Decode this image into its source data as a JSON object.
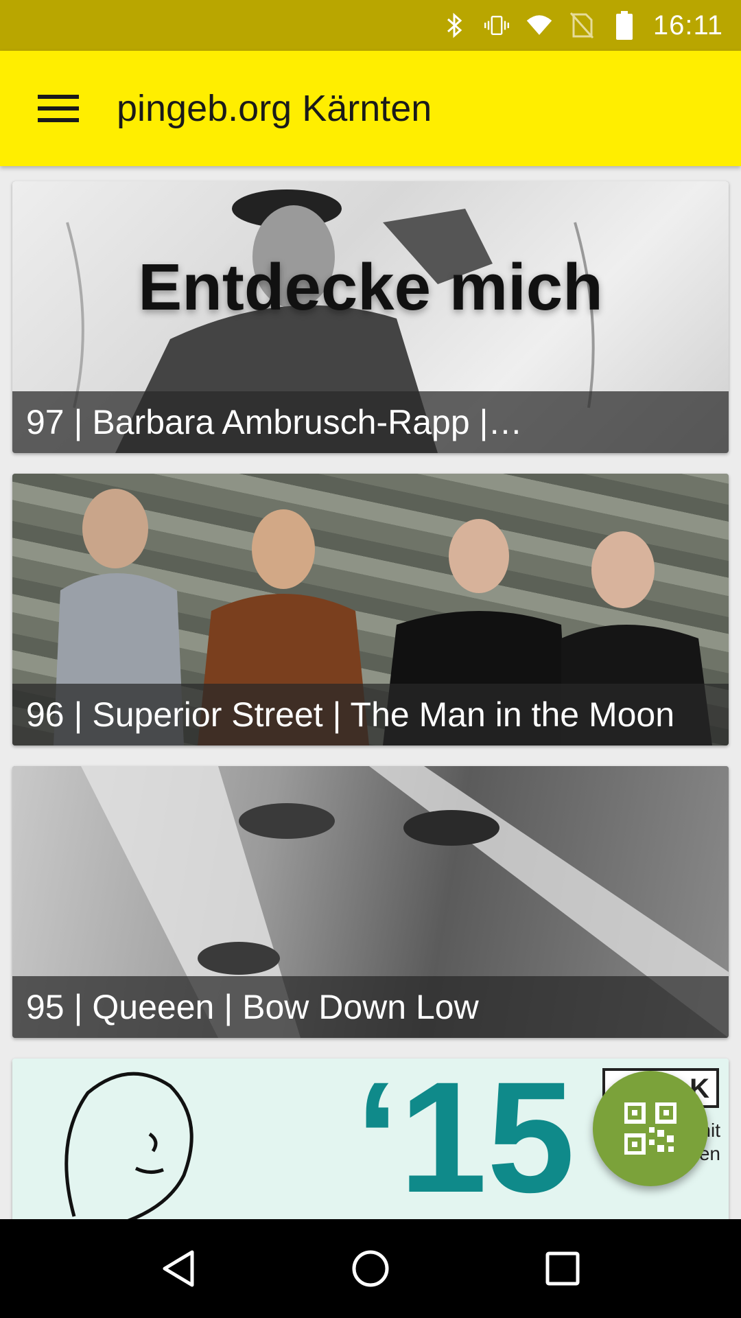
{
  "status_bar": {
    "time": "16:11",
    "icons": [
      "bluetooth-icon",
      "vibrate-icon",
      "wifi-icon",
      "no-sim-icon",
      "battery-icon"
    ]
  },
  "app_bar": {
    "title": "pingeb.org Kärnten",
    "menu_icon": "hamburger-menu-icon"
  },
  "feed": {
    "items": [
      {
        "overlay_text": "Entdecke mich",
        "caption": "97 | Barbara Ambrusch-Rapp |…"
      },
      {
        "caption": "96 | Superior Street | The Man in the Moon"
      },
      {
        "caption": "95 | Queeen | Bow Down Low"
      },
      {
        "year": "‘15",
        "corner_label": "K",
        "corner_text": "nit\nen"
      }
    ]
  },
  "fab": {
    "icon": "qr-code-icon",
    "color": "#7ba23a"
  },
  "nav_bar": {
    "icons": [
      "back-icon",
      "home-icon",
      "recents-icon"
    ]
  },
  "colors": {
    "status_bar": "#b9a600",
    "app_bar": "#ffee00",
    "accent": "#7ba23a"
  }
}
